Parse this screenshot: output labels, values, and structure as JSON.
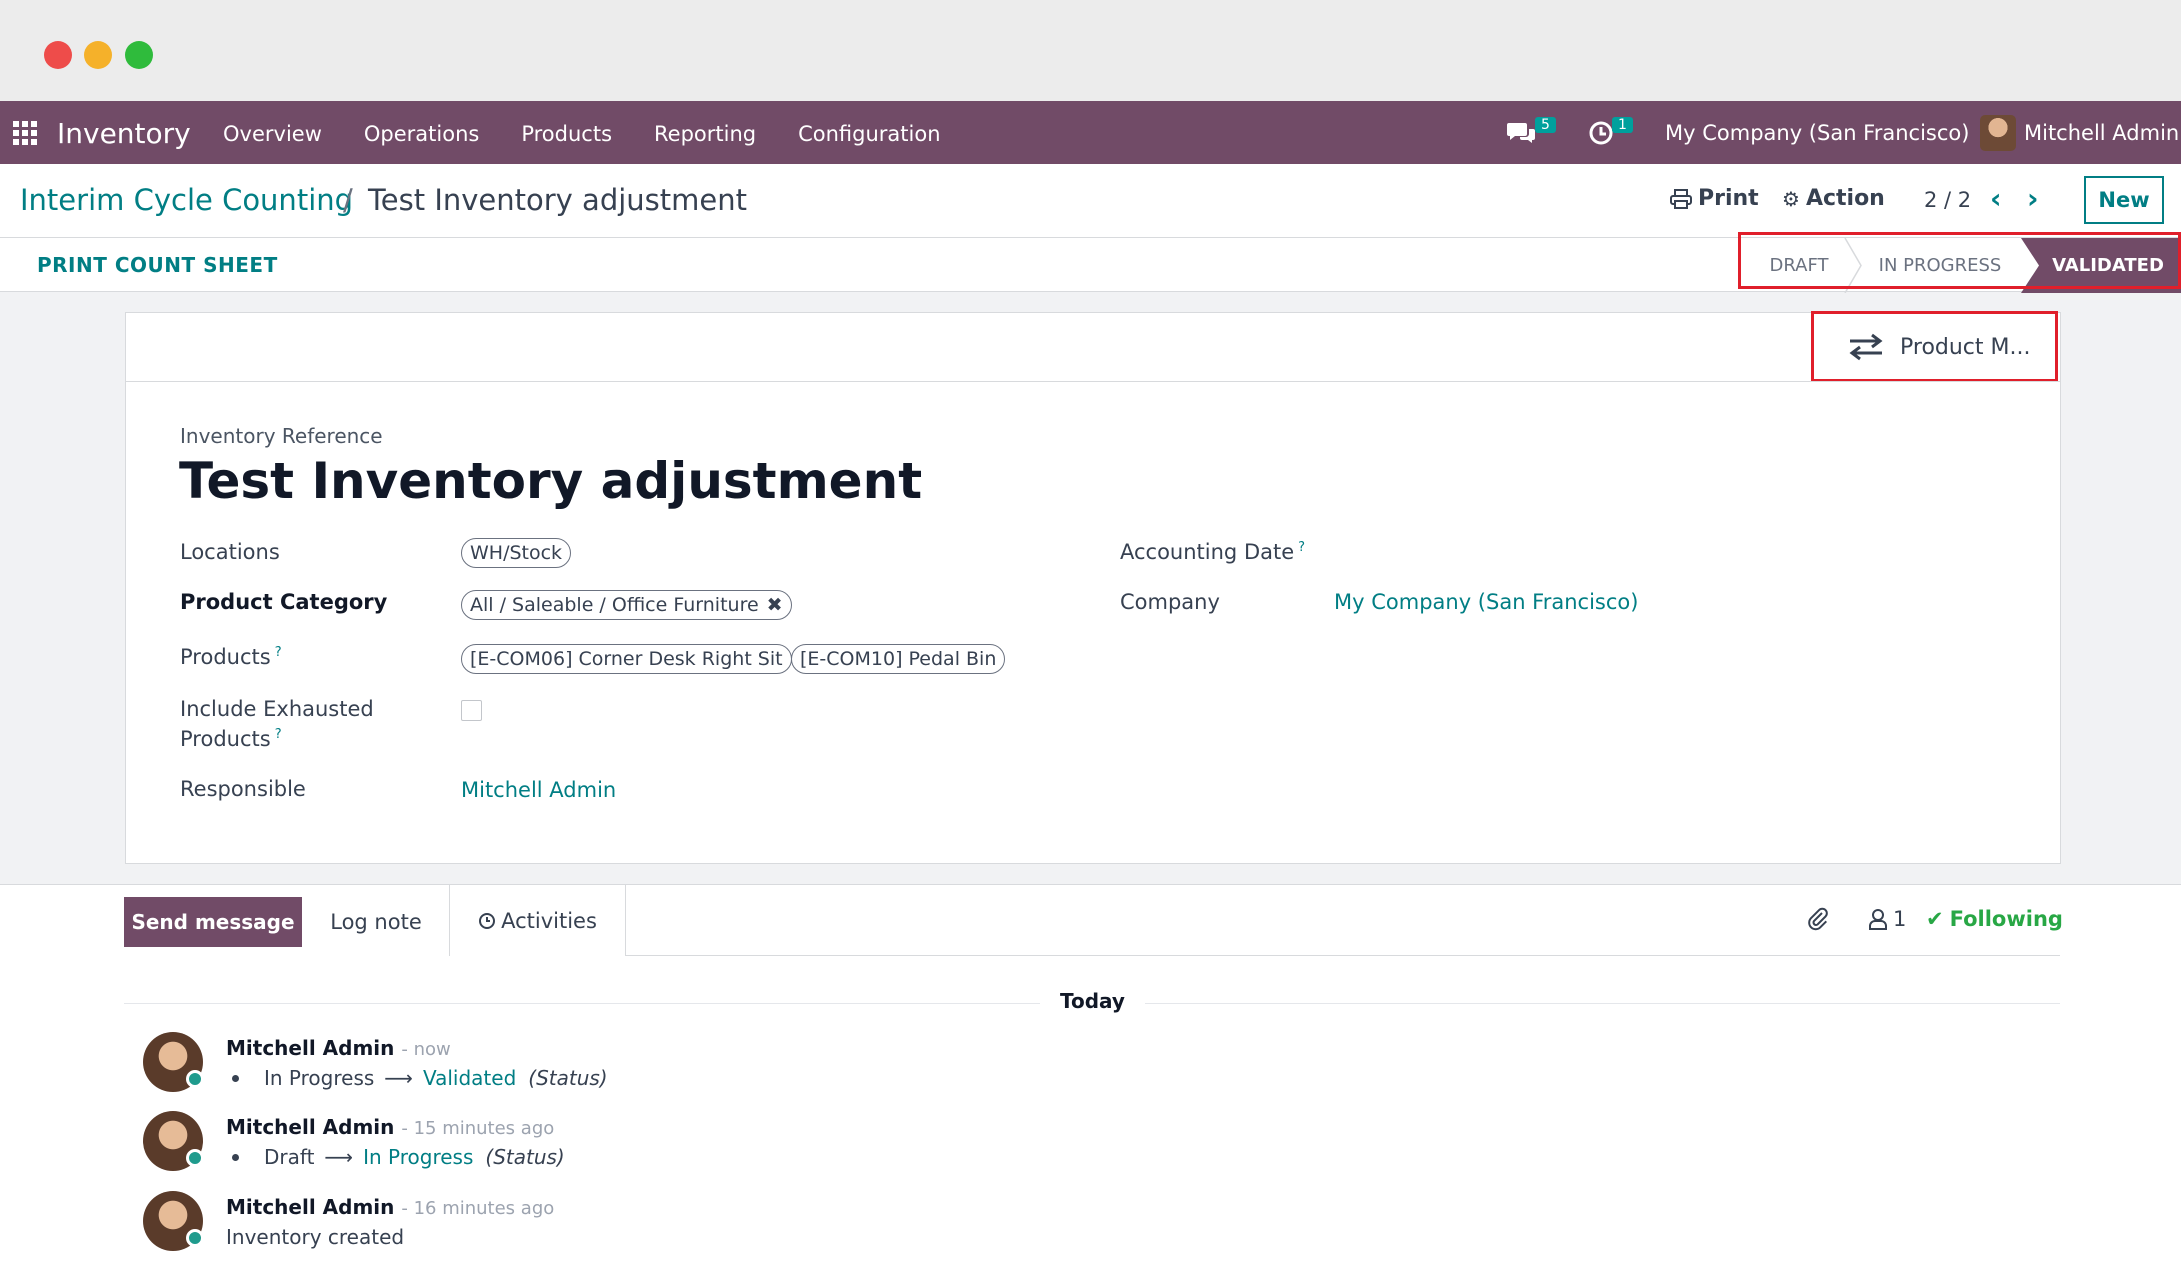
{
  "navbar": {
    "app_name": "Inventory",
    "menu": [
      "Overview",
      "Operations",
      "Products",
      "Reporting",
      "Configuration"
    ],
    "messages_count": "5",
    "activities_count": "1",
    "company": "My Company (San Francisco)",
    "user": "Mitchell Admin",
    "icons": [
      "apps-icon",
      "chat-icon",
      "clock-icon",
      "avatar"
    ]
  },
  "breadcrumb": {
    "parent": "Interim Cycle Counting",
    "separator": "/",
    "current": "Test Inventory adjustment"
  },
  "control_panel": {
    "print": "Print",
    "action": "Action",
    "pager": "2 / 2",
    "new": "New"
  },
  "statusbar": {
    "print_count_sheet": "PRINT COUNT SHEET",
    "stages": [
      "DRAFT",
      "IN PROGRESS",
      "VALIDATED"
    ],
    "active_stage": "VALIDATED"
  },
  "smart_button": {
    "label": "Product M..."
  },
  "form": {
    "reference_label": "Inventory Reference",
    "title": "Test Inventory adjustment",
    "locations_label": "Locations",
    "locations": [
      "WH/Stock"
    ],
    "product_category_label": "Product Category",
    "product_category": "All / Saleable / Office Furniture",
    "products_label": "Products",
    "products": [
      "[E-COM06] Corner Desk Right Sit",
      "[E-COM10] Pedal Bin"
    ],
    "include_exhausted_label_1": "Include Exhausted",
    "include_exhausted_label_2": "Products",
    "include_exhausted_checked": false,
    "responsible_label": "Responsible",
    "responsible": "Mitchell Admin",
    "accounting_date_label": "Accounting Date",
    "company_label": "Company",
    "company": "My Company (San Francisco)",
    "help_mark": "?"
  },
  "chatter": {
    "send_message": "Send message",
    "log_note": "Log note",
    "activities": "Activities",
    "followers_count": "1",
    "following": "Following",
    "date_separator": "Today",
    "messages": [
      {
        "author": "Mitchell Admin",
        "time": "- now",
        "old": "In Progress",
        "new": "Validated",
        "field": "(Status)"
      },
      {
        "author": "Mitchell Admin",
        "time": "- 15 minutes ago",
        "old": "Draft",
        "new": "In Progress",
        "field": "(Status)"
      },
      {
        "author": "Mitchell Admin",
        "time": "- 16 minutes ago",
        "body": "Inventory created"
      }
    ]
  },
  "colors": {
    "brand": "#714b67",
    "accent": "#017e84",
    "highlight": "#e01f2b",
    "following": "#28a745"
  }
}
